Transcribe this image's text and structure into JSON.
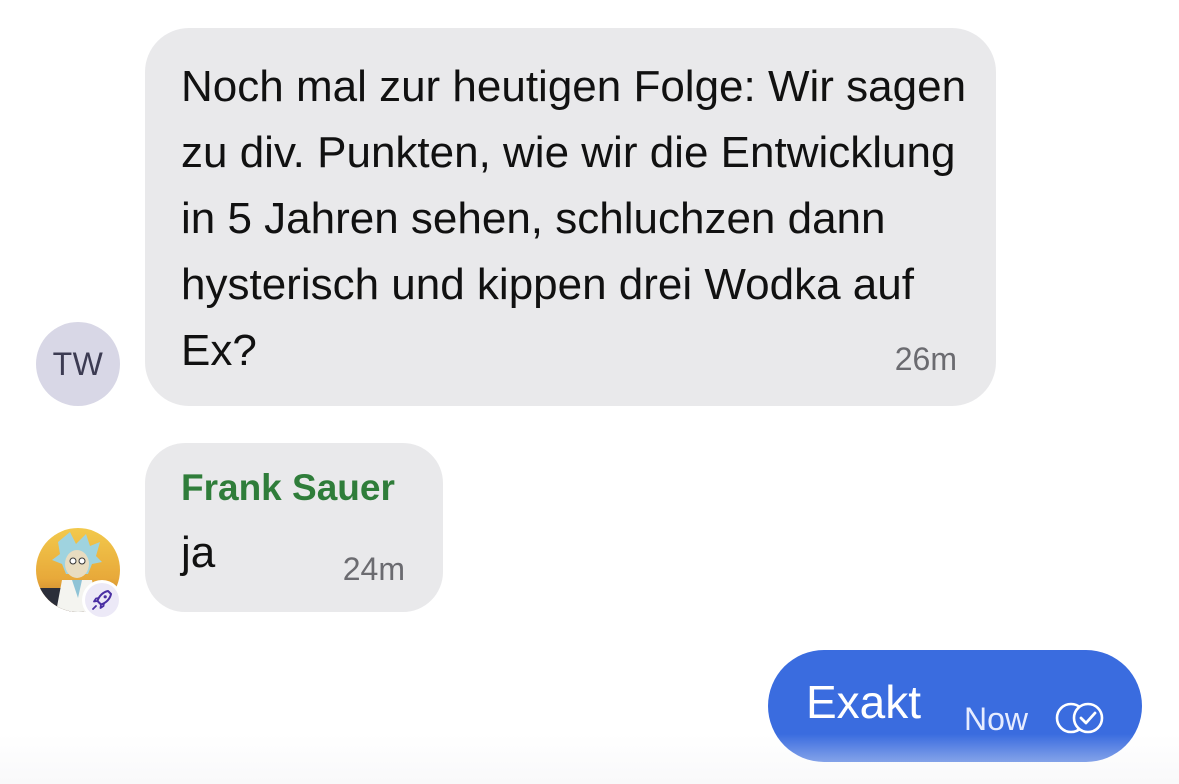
{
  "messages": [
    {
      "avatar_initials": "TW",
      "text": "Noch mal zur heutigen Folge: Wir sagen zu div. Punkten, wie wir die Entwicklung in 5 Jahren sehen, schluchzen dann hysterisch und kippen drei Wodka auf Ex?",
      "time": "26m"
    },
    {
      "sender": "Frank Sauer",
      "text": "ja",
      "time": "24m",
      "avatar_badge_icon": "rocket-icon"
    },
    {
      "text": "Exakt",
      "time": "Now",
      "status_icon": "read-check-icon"
    }
  ],
  "colors": {
    "incoming_bubble": "#e9e9eb",
    "outgoing_bubble": "#3a6cdf",
    "sender_name": "#2f7d3a",
    "timestamp": "#6b6b70",
    "avatar_initials_bg": "#d8d7e6"
  }
}
